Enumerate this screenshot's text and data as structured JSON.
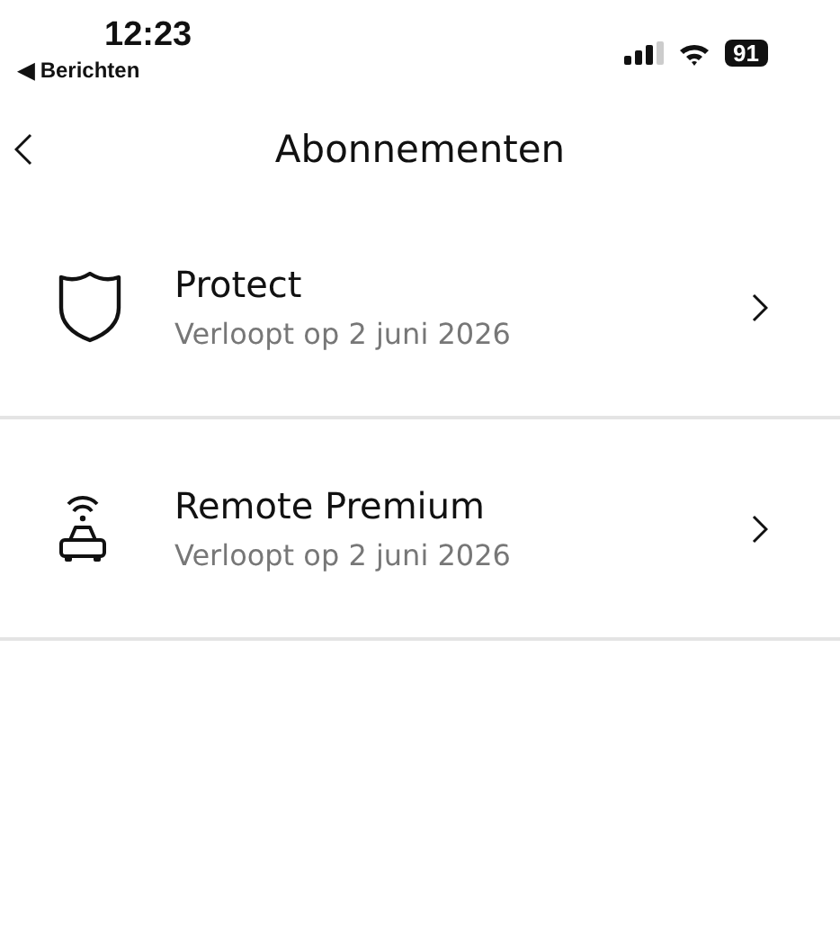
{
  "status_bar": {
    "time": "12:23",
    "back_app": "◀ Berichten",
    "battery": "91"
  },
  "nav": {
    "title": "Abonnementen"
  },
  "subscriptions": [
    {
      "kind": "shield",
      "title": "Protect",
      "subtitle": "Verloopt op 2 juni 2026"
    },
    {
      "kind": "car",
      "title": "Remote Premium",
      "subtitle": "Verloopt op 2 juni 2026"
    }
  ]
}
